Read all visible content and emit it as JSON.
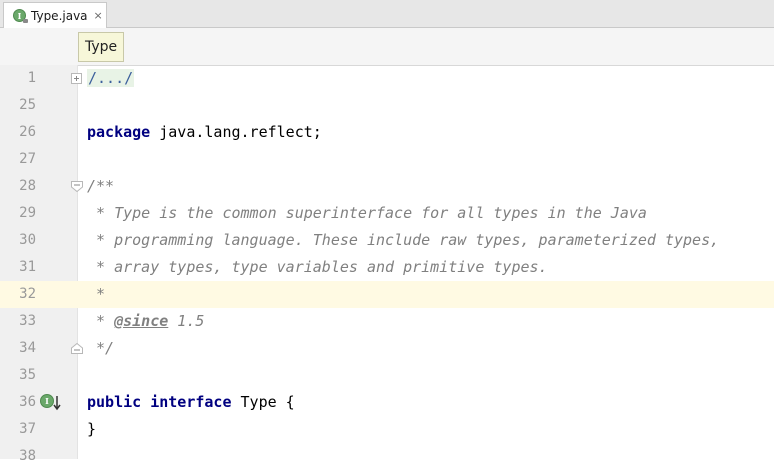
{
  "tab": {
    "icon": "interface-file-icon",
    "label": "Type.java",
    "close": "×"
  },
  "tooltip": {
    "text": "Type"
  },
  "colors": {
    "keyword": "#000080",
    "comment": "#808080",
    "current_line": "#fffae3",
    "folded_region": "#e8f3e6"
  },
  "editor": {
    "current_line": "32",
    "lines": [
      {
        "number": "1",
        "text": "/.../"
      },
      {
        "number": "25",
        "text": ""
      },
      {
        "number": "26",
        "keyword": "package",
        "text": " java.lang.reflect;"
      },
      {
        "number": "27",
        "text": ""
      },
      {
        "number": "28",
        "text": "/**"
      },
      {
        "number": "29",
        "text": " * Type is the common superinterface for all types in the Java"
      },
      {
        "number": "30",
        "text": " * programming language. These include raw types, parameterized types,"
      },
      {
        "number": "31",
        "text": " * array types, type variables and primitive types."
      },
      {
        "number": "32",
        "text": " *"
      },
      {
        "number": "33",
        "prefix": " * ",
        "tag": "@since",
        "text": " 1.5"
      },
      {
        "number": "34",
        "text": " */"
      },
      {
        "number": "35",
        "text": ""
      },
      {
        "number": "36",
        "keyword": "public interface",
        "text": " Type {"
      },
      {
        "number": "37",
        "text": "}"
      },
      {
        "number": "38",
        "text": ""
      }
    ]
  }
}
